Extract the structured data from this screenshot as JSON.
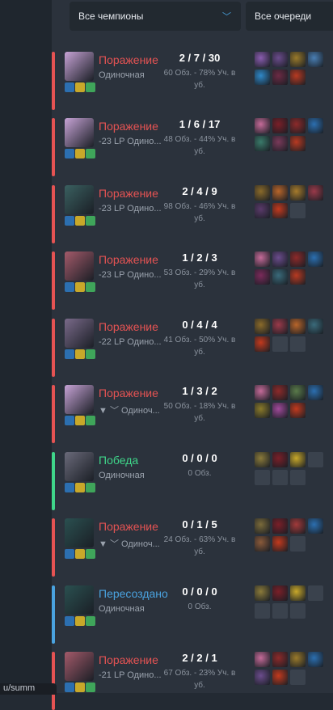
{
  "filters": {
    "champion": "Все чемпионы",
    "queue": "Все очереди"
  },
  "tooltip_url": "u/summ",
  "matches": [
    {
      "result": "Поражение",
      "result_type": "loss",
      "queue": "Одиночная",
      "kda": "2 / 7 / 30",
      "stats_a": "60 Обз. - 78% Уч. в",
      "stats_b": "уб.",
      "champ_color": "#c7a3d6",
      "items": [
        "#8a5db0",
        "#6b4c8c",
        "#9a7a2b",
        "#4a7fb4",
        "#2f88c8",
        "#6c2a44",
        "#b83a22"
      ]
    },
    {
      "result": "Поражение",
      "result_type": "loss",
      "queue": "-23 LP Одино...",
      "kda": "1 / 6 / 17",
      "stats_a": "48 Обз. - 44% Уч. в",
      "stats_b": "уб.",
      "champ_color": "#c7a3d6",
      "items": [
        "#c56b99",
        "#7a1f28",
        "#8d2a2a",
        "#2c6fb0",
        "#3a7a6a",
        "#7a3a5a",
        "#b83a22"
      ]
    },
    {
      "result": "Поражение",
      "result_type": "loss",
      "queue": "-23 LP Одино...",
      "kda": "2 / 4 / 9",
      "stats_a": "98 Обз. - 46% Уч. в",
      "stats_b": "уб.",
      "champ_color": "#3a6060",
      "items": [
        "#8a6a2a",
        "#b8652a",
        "#a67b2c",
        "#9a3a4a",
        "#5a3a6a",
        "#c23a1e",
        "empty"
      ]
    },
    {
      "result": "Поражение",
      "result_type": "loss",
      "queue": "-23 LP Одино...",
      "kda": "1 / 2 / 3",
      "stats_a": "53 Обз. - 29% Уч. в",
      "stats_b": "уб.",
      "champ_color": "#a45a6a",
      "items": [
        "#c56b99",
        "#6b4c8c",
        "#8d2a2a",
        "#2c6fb0",
        "#7a2a5a",
        "#3a6a7a",
        "#b83a22"
      ]
    },
    {
      "result": "Поражение",
      "result_type": "loss",
      "queue": "-22 LP Одино...",
      "kda": "0 / 4 / 4",
      "stats_a": "41 Обз. - 50% Уч. в",
      "stats_b": "уб.",
      "champ_color": "#7a6a8a",
      "items": [
        "#8a6a2a",
        "#9a3a4a",
        "#b8652a",
        "#3a6a7a",
        "#c23a1e",
        "empty",
        "empty"
      ]
    },
    {
      "result": "Поражение",
      "result_type": "loss",
      "queue": "▼ ﹀ Одиноч...",
      "kda": "1 / 3 / 2",
      "stats_a": "50 Обз. - 18% Уч. в",
      "stats_b": "уб.",
      "champ_color": "#c7a3d6",
      "items": [
        "#c56b99",
        "#8d2a2a",
        "#5a7a4a",
        "#2c6fb0",
        "#8a7a2a",
        "#a04a9a",
        "#c23a1e"
      ]
    },
    {
      "result": "Победа",
      "result_type": "win",
      "queue": "Одиночная",
      "kda": "0 / 0 / 0",
      "stats_a": "0 Обз.",
      "stats_b": "",
      "champ_color": "#6a6a7a",
      "items": [
        "#8a7a3a",
        "#7a1f28",
        "#c8a82a",
        "empty",
        "empty",
        "empty",
        "empty"
      ]
    },
    {
      "result": "Поражение",
      "result_type": "loss",
      "queue": "▼ ﹀ Одиноч...",
      "kda": "0 / 1 / 5",
      "stats_a": "24 Обз. - 63% Уч. в",
      "stats_b": "уб.",
      "champ_color": "#2a5050",
      "items": [
        "#7a6a3a",
        "#7a1f28",
        "#a23a3a",
        "#2c6fb0",
        "#8a5a3a",
        "#c23a1e",
        "empty"
      ]
    },
    {
      "result": "Пересоздано",
      "result_type": "remake",
      "queue": "Одиночная",
      "kda": "0 / 0 / 0",
      "stats_a": "0 Обз.",
      "stats_b": "",
      "champ_color": "#2a5050",
      "items": [
        "#8a7a3a",
        "#7a1f28",
        "#c8a82a",
        "empty",
        "empty",
        "empty",
        "empty"
      ]
    },
    {
      "result": "Поражение",
      "result_type": "loss",
      "queue": "-21 LP Одино...",
      "kda": "2 / 2 / 1",
      "stats_a": "67 Обз. - 23% Уч. в",
      "stats_b": "уб.",
      "champ_color": "#a45a6a",
      "items": [
        "#c56b99",
        "#8d2a2a",
        "#9a7a2b",
        "#2c6fb0",
        "#6b4c8c",
        "#c23a1e",
        "empty"
      ]
    }
  ]
}
